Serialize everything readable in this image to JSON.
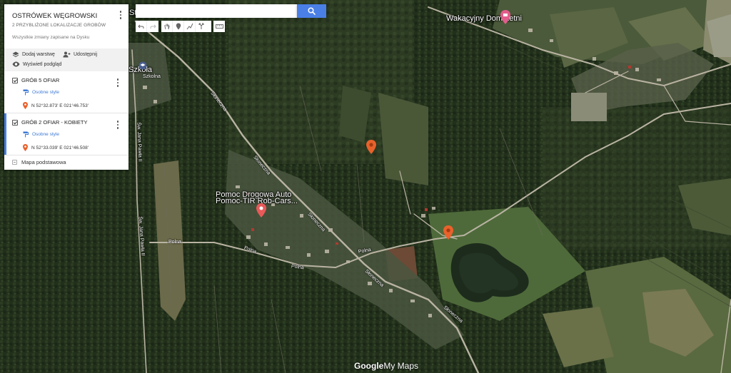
{
  "panel": {
    "title": "OSTRÓWEK WĘGROWSKI",
    "subtitle": "2 PRZYBLIŻONE LOKALIZACJE GROBÓW",
    "saved_status": "Wszystkie zmiany zapisane na Dysku",
    "actions": {
      "add_layer": "Dodaj warstwę",
      "share": "Udostępnij",
      "preview": "Wyświetl podgląd"
    },
    "layers": [
      {
        "name": "GRÓB 5 OFIAR",
        "style_label": "Osobne style",
        "coordinate": "N 52°32.873' E 021°46.753'"
      },
      {
        "name": "GRÓB 2 OFIAR - KOBIETY",
        "style_label": "Osobne style",
        "coordinate": "N 52°33.039' E 021°46.508'"
      }
    ],
    "base_map": "Mapa podstawowa"
  },
  "search": {
    "value": "",
    "placeholder": ""
  },
  "toolbar": {
    "icons": [
      "undo-icon",
      "redo-icon",
      "hand-icon",
      "marker-icon",
      "draw-line-icon",
      "directions-icon",
      "ruler-icon"
    ]
  },
  "map": {
    "places": {
      "wakacyjny": "Wakacyjny Dom Letni",
      "pomoc_line1": "Pomoc Drogowa Auto",
      "pomoc_line2": "Pomoc-TIR Rob-Cars...",
      "szkola": "Szkoła",
      "stacja": "Stacja"
    },
    "streets": {
      "sloneczna_1": "Słoneczna",
      "sloneczna_2": "Słoneczna",
      "sloneczna_3": "Słoneczna",
      "sloneczna_4": "Słoneczna",
      "sloneczna_5": "Słoneczna",
      "polna_1": "Polna",
      "polna_2": "Polna",
      "polna_3": "Polna",
      "polna_4": "Polna",
      "jana_pawla": "Św. Jana Pawła II",
      "jana_pawla_2": "Św. Jana Pawła II",
      "szkolna": "Szkolna"
    },
    "brand_google": "Google",
    "brand_mymaps": "My Maps",
    "colors": {
      "grave_marker": "#e8622c",
      "place_marker": "#e85a5a",
      "accent": "#4a7fe6"
    }
  }
}
